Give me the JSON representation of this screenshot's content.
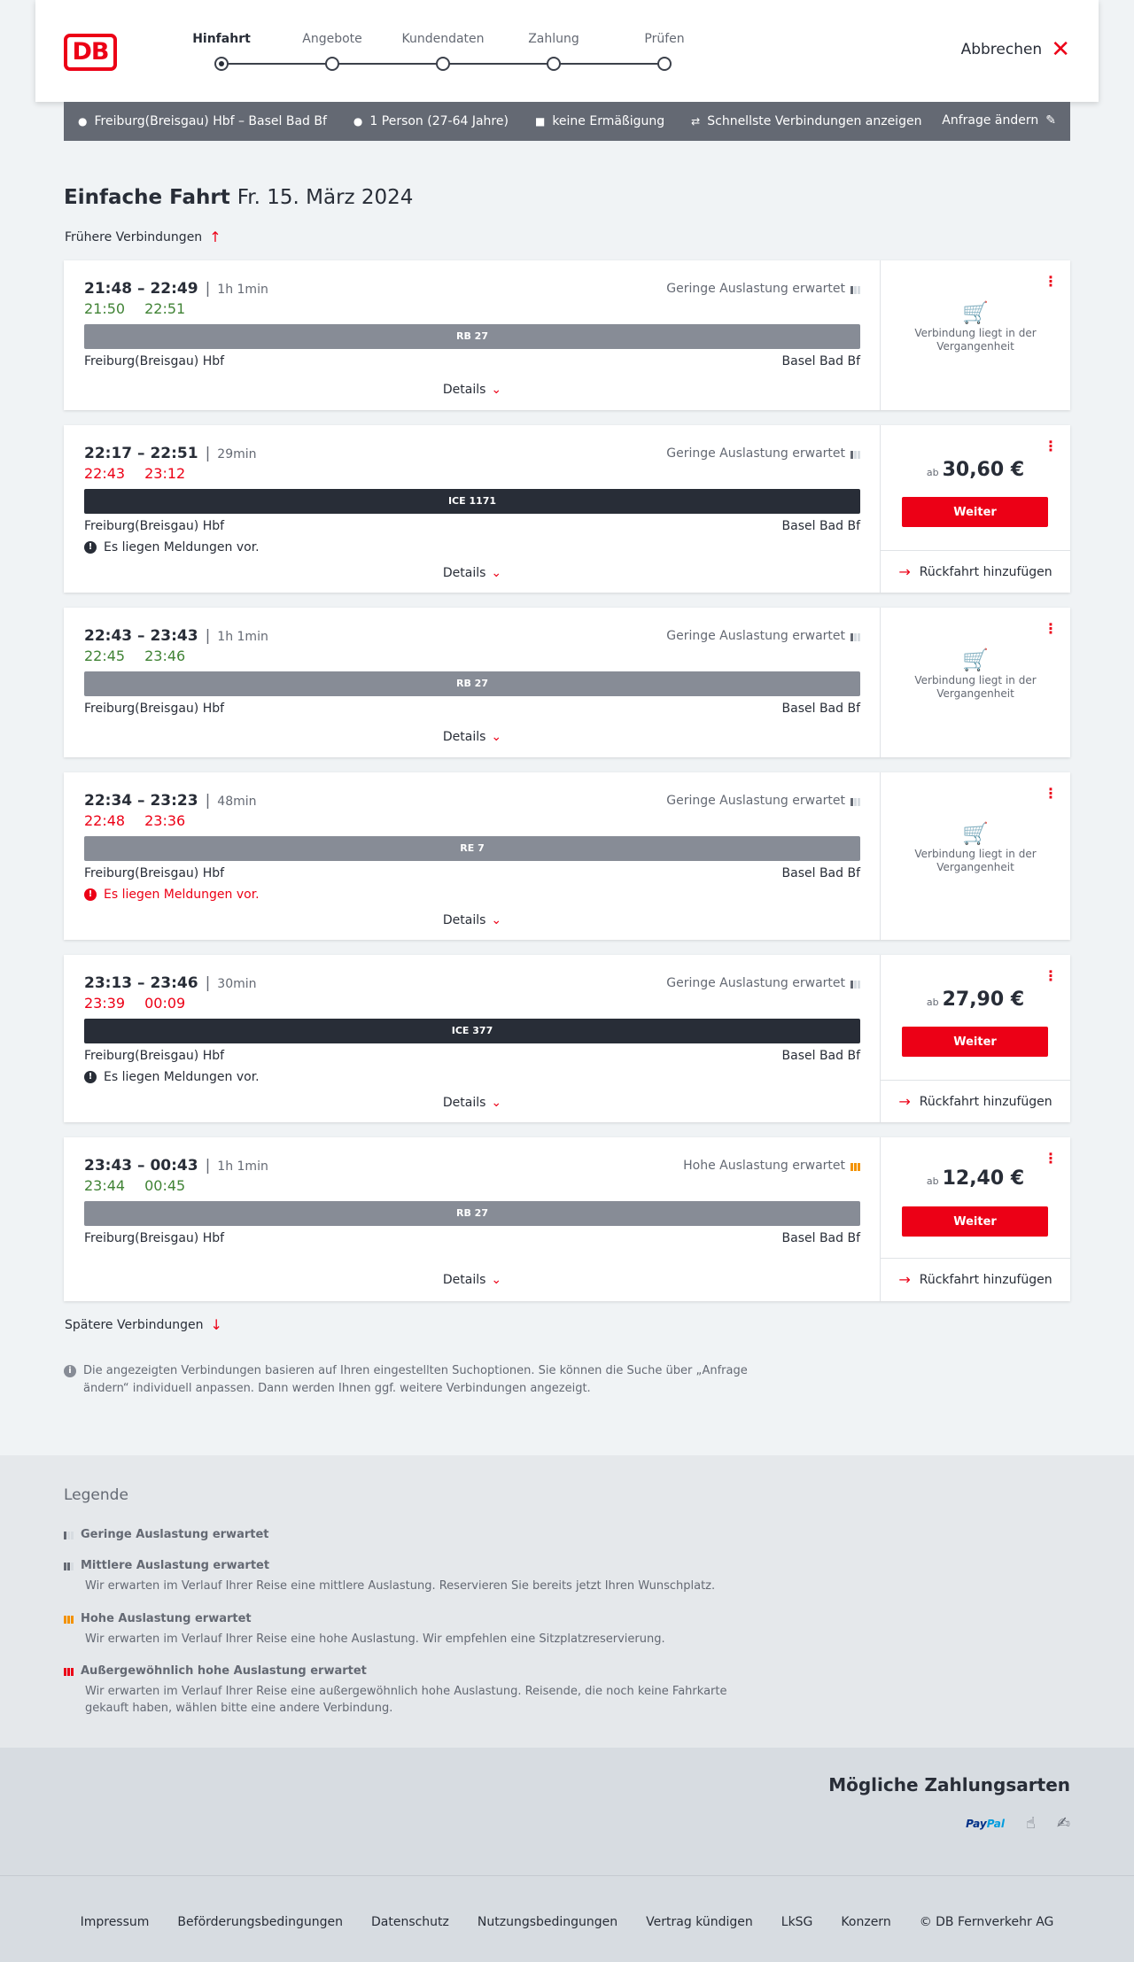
{
  "header": {
    "logo": "DB",
    "steps": [
      {
        "label": "Hinfahrt",
        "active": true
      },
      {
        "label": "Angebote",
        "active": false
      },
      {
        "label": "Kundendaten",
        "active": false
      },
      {
        "label": "Zahlung",
        "active": false
      },
      {
        "label": "Prüfen",
        "active": false
      }
    ],
    "cancel_label": "Abbrechen"
  },
  "searchbar": {
    "route": "Freiburg(Breisgau) Hbf – Basel Bad Bf",
    "passengers": "1 Person (27-64 Jahre)",
    "discount": "keine Ermäßigung",
    "fastest": "Schnellste Verbindungen anzeigen",
    "edit": "Anfrage ändern"
  },
  "page": {
    "title": "Einfache Fahrt",
    "date": "Fr. 15. März 2024",
    "earlier": "Frühere Verbindungen",
    "later": "Spätere Verbindungen",
    "note": "Die angezeigten Verbindungen basieren auf Ihren eingestellten Suchoptionen. Sie können die Suche über „Anfrage ändern“ individuell anpassen. Dann werden Ihnen ggf. weitere Verbindungen angezeigt."
  },
  "common": {
    "details": "Details",
    "weiter": "Weiter",
    "return": "Rückfahrt hinzufügen",
    "past": "Verbindung liegt in der Vergangenheit",
    "from": "Freiburg(Breisgau) Hbf",
    "to": "Basel Bad Bf",
    "ab": "ab"
  },
  "connections": [
    {
      "times": "21:48 – 22:49",
      "duration": "1h 1min",
      "rt_dep": "21:50",
      "rt_arr": "22:51",
      "rt_color": "green",
      "load": "Geringe Auslastung erwartet",
      "load_level": "low",
      "train": "RB 27",
      "train_style": "grey",
      "message": "",
      "price": "",
      "status": "past"
    },
    {
      "times": "22:17 – 22:51",
      "duration": "29min",
      "rt_dep": "22:43",
      "rt_arr": "23:12",
      "rt_color": "red",
      "load": "Geringe Auslastung erwartet",
      "load_level": "low",
      "train": "ICE 1171",
      "train_style": "dark",
      "message": "Es liegen Meldungen vor.",
      "message_style": "normal",
      "price": "30,60 €",
      "status": "bookable"
    },
    {
      "times": "22:43 – 23:43",
      "duration": "1h 1min",
      "rt_dep": "22:45",
      "rt_arr": "23:46",
      "rt_color": "green",
      "load": "Geringe Auslastung erwartet",
      "load_level": "low",
      "train": "RB 27",
      "train_style": "grey",
      "message": "",
      "price": "",
      "status": "past"
    },
    {
      "times": "22:34 – 23:23",
      "duration": "48min",
      "rt_dep": "22:48",
      "rt_arr": "23:36",
      "rt_color": "red",
      "load": "Geringe Auslastung erwartet",
      "load_level": "low",
      "train": "RE 7",
      "train_style": "grey",
      "message": "Es liegen Meldungen vor.",
      "message_style": "red",
      "price": "",
      "status": "past"
    },
    {
      "times": "23:13 – 23:46",
      "duration": "30min",
      "rt_dep": "23:39",
      "rt_arr": "00:09",
      "rt_color": "red",
      "load": "Geringe Auslastung erwartet",
      "load_level": "low",
      "train": "ICE 377",
      "train_style": "dark",
      "message": "Es liegen Meldungen vor.",
      "message_style": "normal",
      "price": "27,90 €",
      "status": "bookable"
    },
    {
      "times": "23:43 – 00:43",
      "duration": "1h 1min",
      "rt_dep": "23:44",
      "rt_arr": "00:45",
      "rt_color": "green",
      "load": "Hohe Auslastung erwartet",
      "load_level": "high",
      "train": "RB 27",
      "train_style": "grey",
      "message": "",
      "price": "12,40 €",
      "status": "bookable"
    }
  ],
  "legend": {
    "title": "Legende",
    "items": [
      {
        "title": "Geringe Auslastung erwartet",
        "desc": "",
        "level": "low"
      },
      {
        "title": "Mittlere Auslastung erwartet",
        "desc": "Wir erwarten im Verlauf Ihrer Reise eine mittlere Auslastung. Reservieren Sie bereits jetzt Ihren Wunschplatz.",
        "level": "mid"
      },
      {
        "title": "Hohe Auslastung erwartet",
        "desc": "Wir erwarten im Verlauf Ihrer Reise eine hohe Auslastung. Wir empfehlen eine Sitzplatzreservierung.",
        "level": "high"
      },
      {
        "title": "Außergewöhnlich hohe Auslastung erwartet",
        "desc": "Wir erwarten im Verlauf Ihrer Reise eine außergewöhnlich hohe Auslastung. Reisende, die noch keine Fahrkarte gekauft haben, wählen bitte eine andere Verbindung.",
        "level": "xhigh"
      }
    ]
  },
  "payment": {
    "title": "Mögliche Zahlungsarten",
    "paypal_a": "Pay",
    "paypal_b": "Pal"
  },
  "footer": [
    "Impressum",
    "Beförderungsbedingungen",
    "Datenschutz",
    "Nutzungsbedingungen",
    "Vertrag kündigen",
    "LkSG",
    "Konzern",
    "© DB Fernverkehr AG"
  ]
}
